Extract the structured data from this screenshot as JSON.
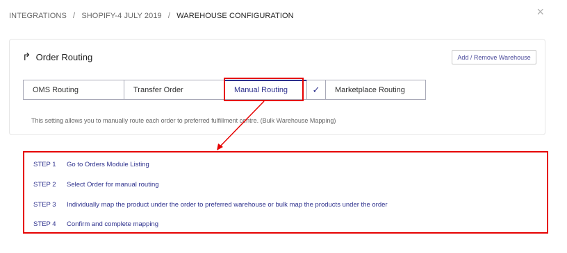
{
  "breadcrumb": {
    "items": [
      "INTEGRATIONS",
      "SHOPIFY-4 JULY 2019",
      "WAREHOUSE CONFIGURATION"
    ],
    "separator": "/"
  },
  "close_icon": "×",
  "card": {
    "icon": "↱",
    "title": "Order Routing",
    "add_button": "Add / Remove Warehouse",
    "tabs": [
      "OMS Routing",
      "Transfer Order",
      "Manual Routing",
      "Marketplace Routing"
    ],
    "active_tab": "Manual Routing",
    "check": "✓",
    "description": "This setting allows you to manually route each order to preferred fulfillment centre. (Bulk Warehouse Mapping)"
  },
  "steps": [
    {
      "num": "STEP 1",
      "text": "Go to Orders Module Listing"
    },
    {
      "num": "STEP 2",
      "text": "Select Order for manual routing"
    },
    {
      "num": "STEP 3",
      "text": "Individually map the product under the order to preferred warehouse or bulk map the products under the order"
    },
    {
      "num": "STEP 4",
      "text": "Confirm and complete mapping"
    }
  ],
  "colors": {
    "accent": "#2c2f8c",
    "highlight": "#e60000"
  }
}
